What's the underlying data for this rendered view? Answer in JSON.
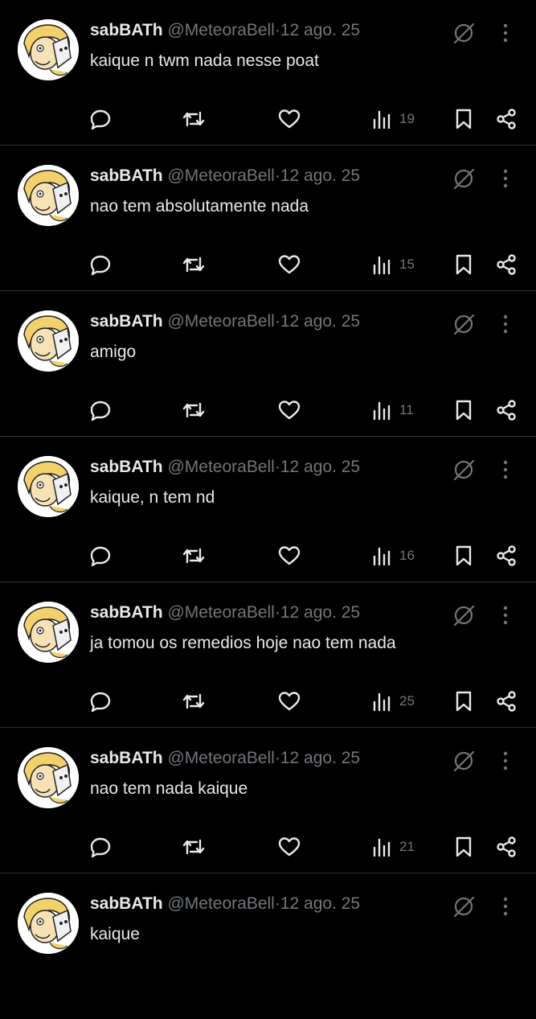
{
  "tweets": [
    {
      "name": "sabBATh",
      "handle": "@MeteoraBell",
      "date": "12 ago. 25",
      "text": "kaique n twm nada nesse poat",
      "views": "19"
    },
    {
      "name": "sabBATh",
      "handle": "@MeteoraBell",
      "date": "12 ago. 25",
      "text": "nao tem absolutamente nada",
      "views": "15"
    },
    {
      "name": "sabBATh",
      "handle": "@MeteoraBell",
      "date": "12 ago. 25",
      "text": "amigo",
      "views": "11"
    },
    {
      "name": "sabBATh",
      "handle": "@MeteoraBell",
      "date": "12 ago. 25",
      "text": "kaique, n tem nd",
      "views": "16"
    },
    {
      "name": "sabBATh",
      "handle": "@MeteoraBell",
      "date": "12 ago. 25",
      "text": "ja tomou os remedios hoje nao tem nada",
      "views": "25"
    },
    {
      "name": "sabBATh",
      "handle": "@MeteoraBell",
      "date": "12 ago. 25",
      "text": "nao tem nada kaique",
      "views": "21"
    },
    {
      "name": "sabBATh",
      "handle": "@MeteoraBell",
      "date": "12 ago. 25",
      "text": "kaique",
      "views": null
    }
  ],
  "separator": "·",
  "icons": {
    "avatar": "cartoon-avatar-icon",
    "grok": "grok-icon",
    "more": "more-vertical-icon",
    "reply": "reply-icon",
    "retweet": "retweet-icon",
    "like": "heart-icon",
    "views": "views-chart-icon",
    "bookmark": "bookmark-icon",
    "share": "share-icon"
  },
  "colors": {
    "background": "#000000",
    "primary_text": "#e7e9ea",
    "secondary_text": "#71767b",
    "divider": "#2f3336"
  }
}
